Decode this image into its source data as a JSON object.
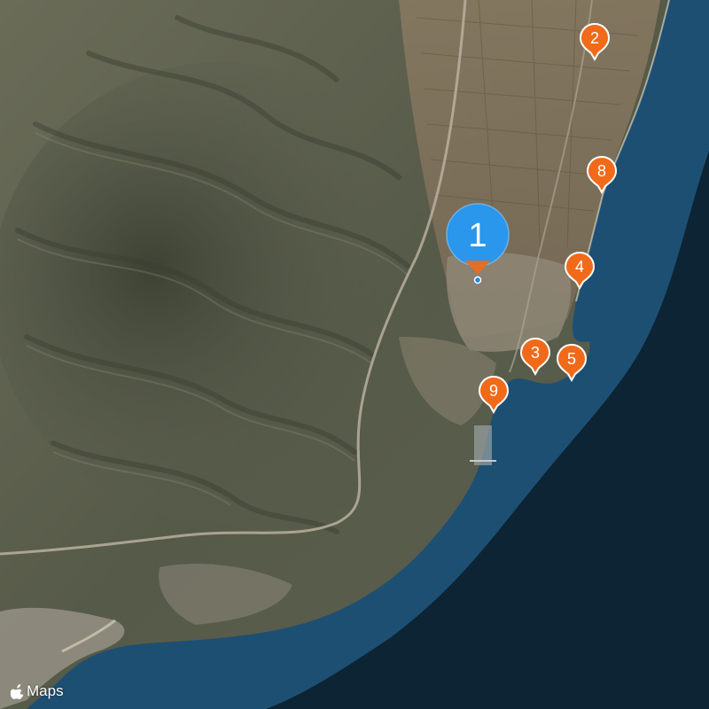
{
  "map": {
    "type": "satellite",
    "colors": {
      "sea_deep": "#0c2433",
      "sea_coast": "#1d4f73",
      "land": "#5a5e4f",
      "pin_orange": "#f06a1a",
      "pin_blue": "#2a96ec"
    }
  },
  "pins": [
    {
      "label": "1",
      "selected": true
    },
    {
      "label": "2"
    },
    {
      "label": "8"
    },
    {
      "label": "4"
    },
    {
      "label": "3"
    },
    {
      "label": "5"
    },
    {
      "label": "9"
    }
  ],
  "attribution": {
    "icon": "apple-logo-icon",
    "text": "Maps"
  }
}
